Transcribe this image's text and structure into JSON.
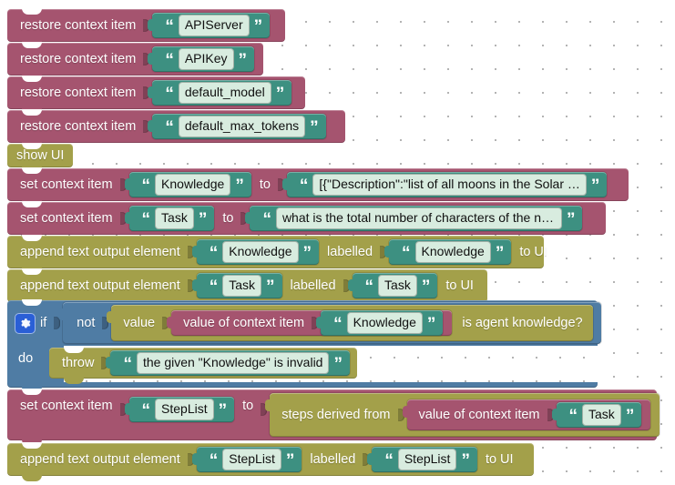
{
  "workspace": {
    "label": "blockly-workspace",
    "background_color": "#ffffff",
    "grid_dot_color": "#9a9a9a"
  },
  "colors": {
    "context_block": "#a5546f",
    "ui_block": "#a3a04a",
    "logic_block": "#4f7ca4",
    "text_block": "#3d9081",
    "field_background": "#d8ecdf",
    "mutator_button": "#2a5fd6"
  },
  "blocks": [
    {
      "id": "restore-1",
      "type": "restore_context_item",
      "label": "restore context item",
      "value": "APIServer"
    },
    {
      "id": "restore-2",
      "type": "restore_context_item",
      "label": "restore context item",
      "value": "APIKey"
    },
    {
      "id": "restore-3",
      "type": "restore_context_item",
      "label": "restore context item",
      "value": "default_model"
    },
    {
      "id": "restore-4",
      "type": "restore_context_item",
      "label": "restore context item",
      "value": "default_max_tokens"
    },
    {
      "id": "show-ui",
      "type": "show_ui",
      "label": "show UI"
    },
    {
      "id": "set-knowledge",
      "type": "set_context_item",
      "label": "set context item",
      "key": "Knowledge",
      "to_label": "to",
      "value": "[{\"Description\":\"list of all moons in the Solar …"
    },
    {
      "id": "set-task",
      "type": "set_context_item",
      "label": "set context item",
      "key": "Task",
      "to_label": "to",
      "value": "what is the total number of characters of the na…"
    },
    {
      "id": "append-knowledge",
      "type": "append_text_output_element",
      "label": "append text output element",
      "element": "Knowledge",
      "labelled_label": "labelled",
      "labelled_value": "Knowledge",
      "to_ui_label": "to UI"
    },
    {
      "id": "append-task",
      "type": "append_text_output_element",
      "label": "append text output element",
      "element": "Task",
      "labelled_label": "labelled",
      "labelled_value": "Task",
      "to_ui_label": "to UI"
    },
    {
      "id": "if-block",
      "type": "controls_if",
      "mutator_icon": "gear-icon",
      "if_label": "if",
      "not_label": "not",
      "value_label": "value",
      "inner_block_label": "value of context item",
      "inner_block_value": "Knowledge",
      "predicate_label": "is agent knowledge?",
      "do_label": "do",
      "throw_label": "throw",
      "throw_value": "the given \"Knowledge\" is invalid"
    },
    {
      "id": "set-steplist",
      "type": "set_context_item",
      "label": "set context item",
      "key": "StepList",
      "to_label": "to",
      "steps_label": "steps derived from",
      "inner_block_label": "value of context item",
      "inner_block_value": "Task"
    },
    {
      "id": "append-steplist",
      "type": "append_text_output_element",
      "label": "append text output element",
      "element": "StepList",
      "labelled_label": "labelled",
      "labelled_value": "StepList",
      "to_ui_label": "to UI"
    }
  ],
  "glyphs": {
    "open_quote": "“",
    "close_quote": "”"
  }
}
